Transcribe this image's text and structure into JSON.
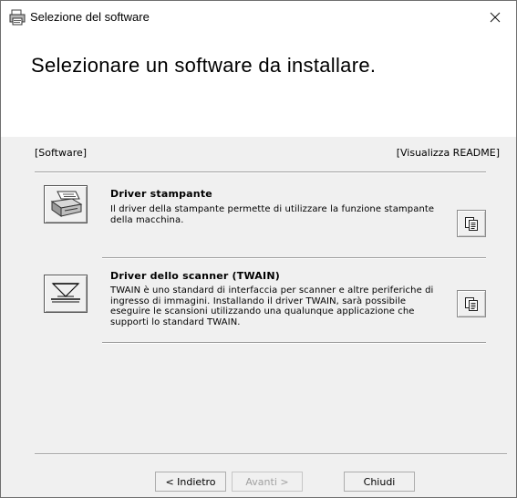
{
  "window": {
    "title": "Selezione del software",
    "heading": "Selezionare un software da installare."
  },
  "labels": {
    "software": "[Software]",
    "readme": "[Visualizza README]"
  },
  "items": [
    {
      "title": "Driver stampante",
      "description": "Il driver della stampante permette di utilizzare la funzione stampante della macchina.",
      "icon": "printer-icon"
    },
    {
      "title": "Driver dello scanner (TWAIN)",
      "description": "TWAIN è uno standard di interfaccia per scanner e altre periferiche di ingresso di immagini. Installando il driver TWAIN, sarà possibile eseguire le scansioni utilizzando una qualunque applicazione che supporti lo standard TWAIN.",
      "icon": "scanner-icon"
    }
  ],
  "buttons": {
    "back": "< Indietro",
    "next": "Avanti >",
    "close": "Chiudi"
  }
}
